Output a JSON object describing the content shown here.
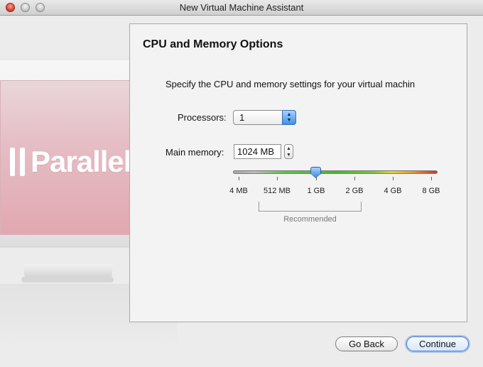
{
  "window": {
    "title": "New Virtual Machine Assistant"
  },
  "branding": {
    "logo_text": "Parallels",
    "logo_trademark": "™"
  },
  "panel": {
    "title": "CPU and Memory Options",
    "description": "Specify the CPU and memory settings for your virtual machin",
    "processors": {
      "label": "Processors:",
      "value": "1"
    },
    "memory": {
      "label": "Main memory:",
      "value": "1024 MB",
      "slider": {
        "ticks": [
          "4 MB",
          "512 MB",
          "1 GB",
          "2 GB",
          "4 GB",
          "8 GB"
        ],
        "selected": "1 GB",
        "recommended_label": "Recommended",
        "recommended_range": [
          "512 MB",
          "2 GB"
        ]
      }
    }
  },
  "buttons": {
    "back": "Go Back",
    "continue": "Continue"
  },
  "icons": {
    "close": "close-button-icon",
    "minimize": "minimize-button-icon",
    "zoom": "zoom-button-icon",
    "popup": "up-down-arrows-icon",
    "stepper": "stepper-arrows-icon"
  },
  "colors": {
    "accent": "#3f8fe6",
    "slider_low": "#a6a6a6",
    "slider_ok": "#49b830",
    "slider_warn": "#e0d63a",
    "slider_high": "#d3312a"
  }
}
